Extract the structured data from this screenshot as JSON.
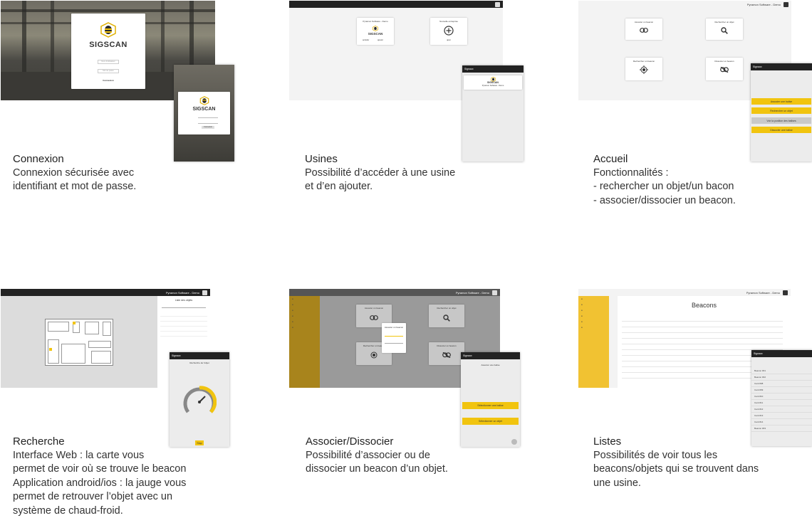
{
  "colors": {
    "accent": "#f1c40f",
    "dark_bar": "#222222",
    "sidebar": "#f1c232"
  },
  "sections": [
    {
      "title": "Connexion",
      "lines": [
        "Connexion sécurisée avec",
        "identifiant et mot de passe."
      ]
    },
    {
      "title": "Usines",
      "lines": [
        "Possibilité d’accéder à une usine",
        "et d’en ajouter."
      ]
    },
    {
      "title": "Accueil",
      "lines": [
        "Fonctionnalités :",
        "- rechercher un objet/un bacon",
        "- associer/dissocier un beacon."
      ]
    },
    {
      "title": "Recherche",
      "lines": [
        "Interface Web : la carte vous",
        "permet de voir où se trouve le beacon",
        "Application android/ios : la jauge vous",
        "permet de retrouver l’objet avec un",
        "système de chaud-froid."
      ]
    },
    {
      "title": "Associer/Dissocier",
      "lines": [
        "Possibilité d’associer ou de",
        "dissocier un beacon d’un objet."
      ]
    },
    {
      "title": "Listes",
      "lines": [
        "Possibilités de voir tous les",
        "beacons/objets qui se trouvent dans",
        "une usine."
      ]
    }
  ],
  "login": {
    "brand": "SIGSCAN",
    "field1": "Nom d'utilisateur",
    "field2": "Mot de passe",
    "submit": "Connexion"
  },
  "usines": {
    "card1": "Pyramon Software - Demo",
    "card1_brand": "SIGSCAN",
    "card1_a": "accéder",
    "card1_b": "ajouter",
    "card2": "Nouvelle entreprise",
    "card2_sub": "ajout",
    "phone_title": "Signaux",
    "phone_card": "Pyramon Software - Demo"
  },
  "accueil": {
    "cards": [
      "Associer un beacon",
      "Rechercher un objet",
      "Rechercher un beacon",
      "Dissocier un beacon"
    ],
    "phone_title": "Signaux",
    "phone_buttons": [
      "Associer une balise",
      "Rechercher un objet",
      "Voir la position des balises",
      "Dissocier une balise"
    ]
  },
  "recherche": {
    "brand": "Pyramon Software - Demo",
    "list_title": "Liste des objets",
    "phone_title": "Signaux",
    "phone_sub": "Recherche de l'objet",
    "phone_btn": "Stop"
  },
  "associer": {
    "brand": "Pyramon Software - Demo",
    "cards": [
      "Associer un beacon",
      "Rechercher un objet",
      "Rechercher un beacon",
      "Dissocier un beacon"
    ],
    "dialog": "Associer un beacon",
    "phone_title": "Signaux",
    "phone_sub": "Associer une balise",
    "phone_buttons": [
      "Sélectionner une balise",
      "Sélectionner un objet"
    ]
  },
  "listes": {
    "brand": "Pyramon Software - Demo",
    "heading": "Beacons",
    "phone_title": "Signaux",
    "phone_items": [
      "Beacon #01",
      "Beacon #02",
      "Card #08",
      "Card #09",
      "Card #10",
      "Card #11",
      "Card #12",
      "Card #13",
      "Card #14",
      "Beacon #03"
    ]
  }
}
